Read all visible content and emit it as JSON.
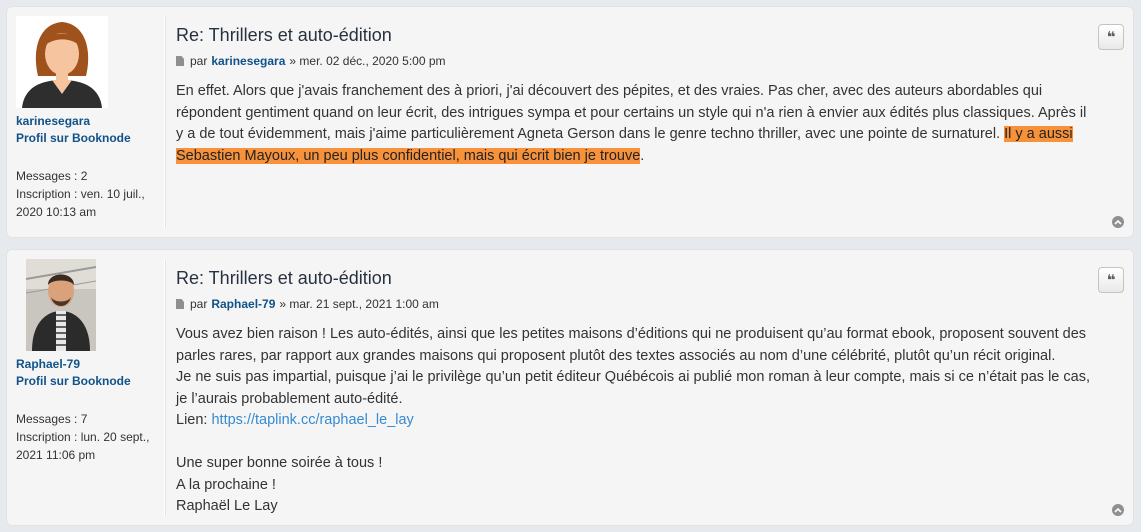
{
  "posts": [
    {
      "username": "karinesegara",
      "profile_link": "Profil sur Booknode",
      "messages_label": "Messages :",
      "messages_value": "2",
      "joined_label": "Inscription :",
      "joined_value": "ven. 10 juil., 2020 10:13 am",
      "title": "Re: Thrillers et auto-édition",
      "by": "par",
      "author": "karinesegara",
      "date": "» mer. 02 déc., 2020 5:00 pm",
      "body_text": "En effet. Alors que j'avais franchement des à priori, j'ai découvert des pépites, et des vraies. Pas cher, avec des auteurs abordables qui répondent gentiment quand on leur écrit, des intrigues sympa et pour certains un style qui n'a rien à envier aux édités plus classiques. Après il y a de tout évidemment, mais j'aime particulièrement Agneta Gerson dans le genre techno thriller, avec une pointe de surnaturel. ",
      "body_highlight": "Il y a aussi Sebastien Mayoux, un peu plus confidentiel, mais qui écrit bien je trouve",
      "body_end": "."
    },
    {
      "username": "Raphael-79",
      "profile_link": "Profil sur Booknode",
      "messages_label": "Messages :",
      "messages_value": "7",
      "joined_label": "Inscription :",
      "joined_value": "lun. 20 sept., 2021 11:06 pm",
      "title": "Re: Thrillers et auto-édition",
      "by": "par",
      "author": "Raphael-79",
      "date": "» mar. 21 sept., 2021 1:00 am",
      "line1": "Vous avez bien raison ! Les auto-édités, ainsi que les petites maisons d’éditions qui ne produisent qu’au format ebook, proposent souvent des parles rares, par rapport aux grandes maisons qui proposent plutôt des textes associés au nom d’une célébrité, plutôt qu’un récit original.",
      "line2": "Je ne suis pas impartial, puisque j’ai le privilège qu’un petit éditeur Québécois ai publié mon roman à leur compte, mais si ce n’était pas le cas, je l’aurais probablement auto-édité.",
      "link_label": "Lien: ",
      "link_url": "https://taplink.cc/raphael_le_lay",
      "line3": "Une super bonne soirée à tous !",
      "line4": "A la prochaine !",
      "line5": "Raphaël Le Lay"
    }
  ],
  "quote_icon": "quote-icon",
  "top_icon": "back-to-top-icon"
}
